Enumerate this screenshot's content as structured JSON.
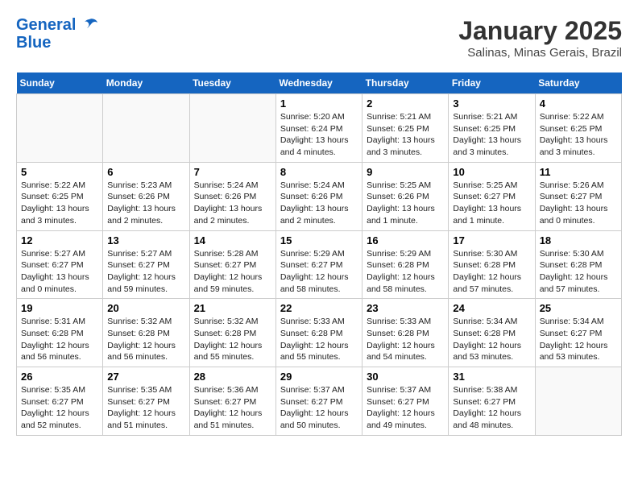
{
  "header": {
    "logo_line1": "General",
    "logo_line2": "Blue",
    "month_title": "January 2025",
    "location": "Salinas, Minas Gerais, Brazil"
  },
  "days_of_week": [
    "Sunday",
    "Monday",
    "Tuesday",
    "Wednesday",
    "Thursday",
    "Friday",
    "Saturday"
  ],
  "weeks": [
    [
      {
        "day": null
      },
      {
        "day": null
      },
      {
        "day": null
      },
      {
        "day": "1",
        "sunrise": "5:20 AM",
        "sunset": "6:24 PM",
        "daylight": "13 hours and 4 minutes."
      },
      {
        "day": "2",
        "sunrise": "5:21 AM",
        "sunset": "6:25 PM",
        "daylight": "13 hours and 3 minutes."
      },
      {
        "day": "3",
        "sunrise": "5:21 AM",
        "sunset": "6:25 PM",
        "daylight": "13 hours and 3 minutes."
      },
      {
        "day": "4",
        "sunrise": "5:22 AM",
        "sunset": "6:25 PM",
        "daylight": "13 hours and 3 minutes."
      }
    ],
    [
      {
        "day": "5",
        "sunrise": "5:22 AM",
        "sunset": "6:25 PM",
        "daylight": "13 hours and 3 minutes."
      },
      {
        "day": "6",
        "sunrise": "5:23 AM",
        "sunset": "6:26 PM",
        "daylight": "13 hours and 2 minutes."
      },
      {
        "day": "7",
        "sunrise": "5:24 AM",
        "sunset": "6:26 PM",
        "daylight": "13 hours and 2 minutes."
      },
      {
        "day": "8",
        "sunrise": "5:24 AM",
        "sunset": "6:26 PM",
        "daylight": "13 hours and 2 minutes."
      },
      {
        "day": "9",
        "sunrise": "5:25 AM",
        "sunset": "6:26 PM",
        "daylight": "13 hours and 1 minute."
      },
      {
        "day": "10",
        "sunrise": "5:25 AM",
        "sunset": "6:27 PM",
        "daylight": "13 hours and 1 minute."
      },
      {
        "day": "11",
        "sunrise": "5:26 AM",
        "sunset": "6:27 PM",
        "daylight": "13 hours and 0 minutes."
      }
    ],
    [
      {
        "day": "12",
        "sunrise": "5:27 AM",
        "sunset": "6:27 PM",
        "daylight": "13 hours and 0 minutes."
      },
      {
        "day": "13",
        "sunrise": "5:27 AM",
        "sunset": "6:27 PM",
        "daylight": "12 hours and 59 minutes."
      },
      {
        "day": "14",
        "sunrise": "5:28 AM",
        "sunset": "6:27 PM",
        "daylight": "12 hours and 59 minutes."
      },
      {
        "day": "15",
        "sunrise": "5:29 AM",
        "sunset": "6:27 PM",
        "daylight": "12 hours and 58 minutes."
      },
      {
        "day": "16",
        "sunrise": "5:29 AM",
        "sunset": "6:28 PM",
        "daylight": "12 hours and 58 minutes."
      },
      {
        "day": "17",
        "sunrise": "5:30 AM",
        "sunset": "6:28 PM",
        "daylight": "12 hours and 57 minutes."
      },
      {
        "day": "18",
        "sunrise": "5:30 AM",
        "sunset": "6:28 PM",
        "daylight": "12 hours and 57 minutes."
      }
    ],
    [
      {
        "day": "19",
        "sunrise": "5:31 AM",
        "sunset": "6:28 PM",
        "daylight": "12 hours and 56 minutes."
      },
      {
        "day": "20",
        "sunrise": "5:32 AM",
        "sunset": "6:28 PM",
        "daylight": "12 hours and 56 minutes."
      },
      {
        "day": "21",
        "sunrise": "5:32 AM",
        "sunset": "6:28 PM",
        "daylight": "12 hours and 55 minutes."
      },
      {
        "day": "22",
        "sunrise": "5:33 AM",
        "sunset": "6:28 PM",
        "daylight": "12 hours and 55 minutes."
      },
      {
        "day": "23",
        "sunrise": "5:33 AM",
        "sunset": "6:28 PM",
        "daylight": "12 hours and 54 minutes."
      },
      {
        "day": "24",
        "sunrise": "5:34 AM",
        "sunset": "6:28 PM",
        "daylight": "12 hours and 53 minutes."
      },
      {
        "day": "25",
        "sunrise": "5:34 AM",
        "sunset": "6:27 PM",
        "daylight": "12 hours and 53 minutes."
      }
    ],
    [
      {
        "day": "26",
        "sunrise": "5:35 AM",
        "sunset": "6:27 PM",
        "daylight": "12 hours and 52 minutes."
      },
      {
        "day": "27",
        "sunrise": "5:35 AM",
        "sunset": "6:27 PM",
        "daylight": "12 hours and 51 minutes."
      },
      {
        "day": "28",
        "sunrise": "5:36 AM",
        "sunset": "6:27 PM",
        "daylight": "12 hours and 51 minutes."
      },
      {
        "day": "29",
        "sunrise": "5:37 AM",
        "sunset": "6:27 PM",
        "daylight": "12 hours and 50 minutes."
      },
      {
        "day": "30",
        "sunrise": "5:37 AM",
        "sunset": "6:27 PM",
        "daylight": "12 hours and 49 minutes."
      },
      {
        "day": "31",
        "sunrise": "5:38 AM",
        "sunset": "6:27 PM",
        "daylight": "12 hours and 48 minutes."
      },
      {
        "day": null
      }
    ]
  ]
}
